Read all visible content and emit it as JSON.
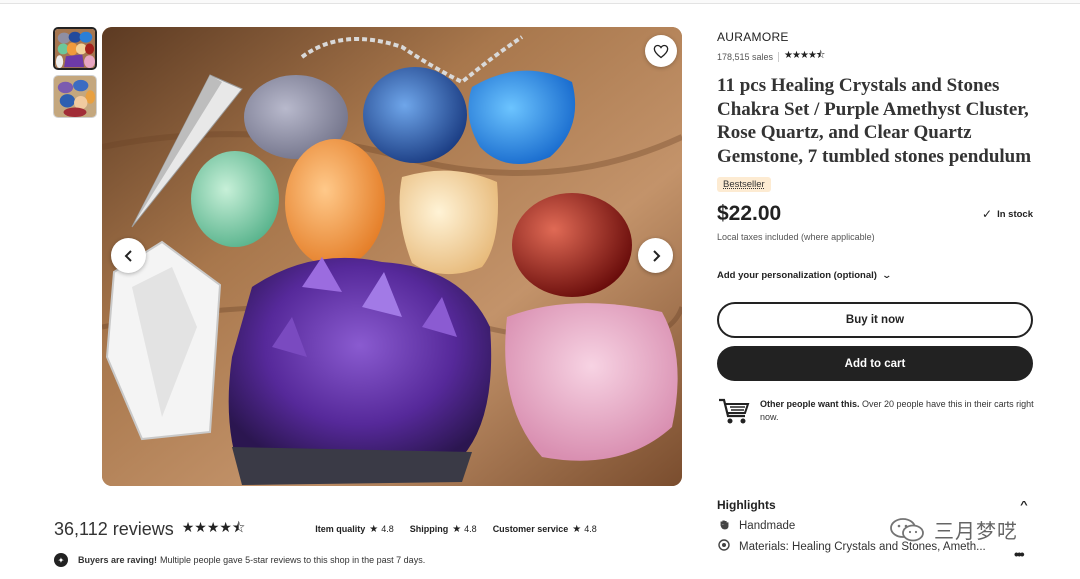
{
  "listing": {
    "shop_name": "AURAMORE",
    "sales": "178,515 sales",
    "rating_stars": "★★★★⯪",
    "title": "11 pcs Healing Crystals and Stones Chakra Set / Purple Amethyst Cluster, Rose Quartz, and Clear Quartz Gemstone, 7 tumbled stones pendulum",
    "badge": "Bestseller",
    "price": "$22.00",
    "stock_check": "✓",
    "stock": "In stock",
    "tax_note": "Local taxes included (where applicable)",
    "personalization": "Add your personalization (optional)",
    "personalization_chevron": "⌄",
    "buy_now": "Buy it now",
    "add_to_cart": "Add to cart",
    "demand_bold": "Other people want this.",
    "demand_text": " Over 20 people have this in their carts right now."
  },
  "highlights": {
    "heading": "Highlights",
    "caret": "^",
    "items": [
      "Handmade",
      "Materials: Healing Crystals and Stones, Ameth..."
    ]
  },
  "reviews": {
    "count": "36,112 reviews",
    "stars": "★★★★⯪",
    "metrics": [
      {
        "label": "Item quality",
        "star": "★",
        "value": "4.8"
      },
      {
        "label": "Shipping",
        "star": "★",
        "value": "4.8"
      },
      {
        "label": "Customer service",
        "star": "★",
        "value": "4.8"
      }
    ],
    "raving_bold": "Buyers are raving!",
    "raving_text": "Multiple people gave 5-star reviews to this shop in the past 7 days."
  },
  "gallery": {
    "prev_icon": "‹",
    "next_icon": "›",
    "favorite_icon": "heart-icon"
  },
  "watermark": {
    "text": "三月梦呓",
    "more": "•••"
  }
}
